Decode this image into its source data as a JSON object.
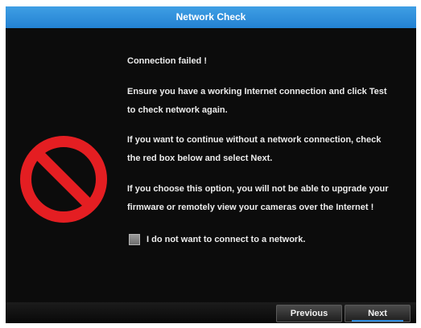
{
  "dialog": {
    "title": "Network Check"
  },
  "message": {
    "line1": "Connection failed !",
    "line2": "Ensure you have a working Internet connection and click Test",
    "line3": "to check network again.",
    "line4": "If you want to continue without a network connection, check",
    "line5": "the red box below and select Next.",
    "line6": "If you choose this option, you will not be able to upgrade your",
    "line7": "firmware or remotely view your cameras over the Internet !"
  },
  "checkbox": {
    "label": "I do not want to connect to a network.",
    "checked": false
  },
  "footer": {
    "previous_label": "Previous",
    "next_label": "Next"
  },
  "icons": {
    "warning": "no-entry-icon"
  },
  "colors": {
    "title_bar": "#2381d2",
    "background": "#0c0c0c",
    "prohibit_red": "#e41e22",
    "accent_underline": "#2f8de0"
  }
}
